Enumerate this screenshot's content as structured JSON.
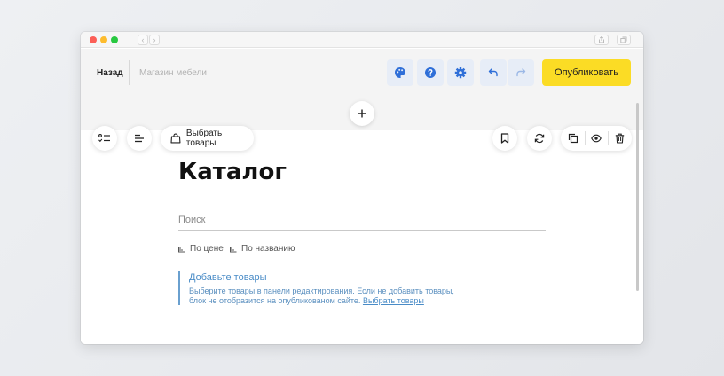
{
  "editor_header": {
    "back_label": "Назад",
    "site_name": "Магазин мебели",
    "publish_label": "Опубликовать"
  },
  "block_toolbar": {
    "select_products_label": "Выбрать товары"
  },
  "catalog": {
    "title": "Каталог",
    "search_placeholder": "Поиск",
    "sort_by_price": "По цене",
    "sort_by_name": "По названию"
  },
  "notice": {
    "title": "Добавьте товары",
    "text": "Выберите товары в панели редактирования. Если не добавить товары, блок не отобразится на опубликованом сайте.",
    "link": "Выбрать товары"
  },
  "icons": {
    "palette": "palette-icon",
    "help": "help-icon",
    "settings": "gear-icon",
    "undo": "undo-icon",
    "redo": "redo-icon",
    "add": "plus-icon",
    "checklist": "checklist-icon",
    "align": "align-left-icon",
    "bag": "shopping-bag-icon",
    "bookmark": "bookmark-icon",
    "refresh": "refresh-icon",
    "copy": "copy-icon",
    "eye": "eye-icon",
    "trash": "trash-icon"
  },
  "colors": {
    "accent_blue": "#2f6fd8",
    "publish_yellow": "#fbdc25",
    "notice_blue": "#4a8cc7"
  }
}
